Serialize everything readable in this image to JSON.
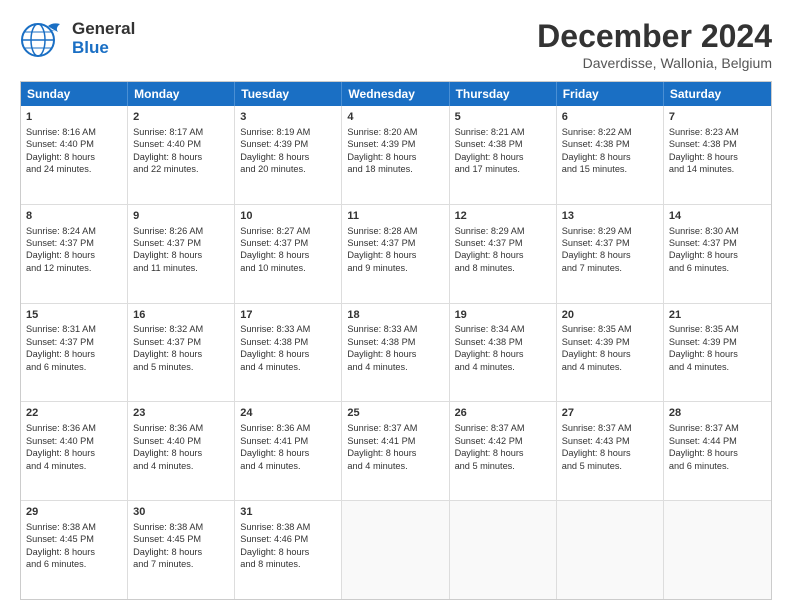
{
  "header": {
    "logo_line1": "General",
    "logo_line2": "Blue",
    "month": "December 2024",
    "location": "Daverdisse, Wallonia, Belgium"
  },
  "days_of_week": [
    "Sunday",
    "Monday",
    "Tuesday",
    "Wednesday",
    "Thursday",
    "Friday",
    "Saturday"
  ],
  "weeks": [
    [
      {
        "day": "1",
        "lines": [
          "Sunrise: 8:16 AM",
          "Sunset: 4:40 PM",
          "Daylight: 8 hours",
          "and 24 minutes."
        ]
      },
      {
        "day": "2",
        "lines": [
          "Sunrise: 8:17 AM",
          "Sunset: 4:40 PM",
          "Daylight: 8 hours",
          "and 22 minutes."
        ]
      },
      {
        "day": "3",
        "lines": [
          "Sunrise: 8:19 AM",
          "Sunset: 4:39 PM",
          "Daylight: 8 hours",
          "and 20 minutes."
        ]
      },
      {
        "day": "4",
        "lines": [
          "Sunrise: 8:20 AM",
          "Sunset: 4:39 PM",
          "Daylight: 8 hours",
          "and 18 minutes."
        ]
      },
      {
        "day": "5",
        "lines": [
          "Sunrise: 8:21 AM",
          "Sunset: 4:38 PM",
          "Daylight: 8 hours",
          "and 17 minutes."
        ]
      },
      {
        "day": "6",
        "lines": [
          "Sunrise: 8:22 AM",
          "Sunset: 4:38 PM",
          "Daylight: 8 hours",
          "and 15 minutes."
        ]
      },
      {
        "day": "7",
        "lines": [
          "Sunrise: 8:23 AM",
          "Sunset: 4:38 PM",
          "Daylight: 8 hours",
          "and 14 minutes."
        ]
      }
    ],
    [
      {
        "day": "8",
        "lines": [
          "Sunrise: 8:24 AM",
          "Sunset: 4:37 PM",
          "Daylight: 8 hours",
          "and 12 minutes."
        ]
      },
      {
        "day": "9",
        "lines": [
          "Sunrise: 8:26 AM",
          "Sunset: 4:37 PM",
          "Daylight: 8 hours",
          "and 11 minutes."
        ]
      },
      {
        "day": "10",
        "lines": [
          "Sunrise: 8:27 AM",
          "Sunset: 4:37 PM",
          "Daylight: 8 hours",
          "and 10 minutes."
        ]
      },
      {
        "day": "11",
        "lines": [
          "Sunrise: 8:28 AM",
          "Sunset: 4:37 PM",
          "Daylight: 8 hours",
          "and 9 minutes."
        ]
      },
      {
        "day": "12",
        "lines": [
          "Sunrise: 8:29 AM",
          "Sunset: 4:37 PM",
          "Daylight: 8 hours",
          "and 8 minutes."
        ]
      },
      {
        "day": "13",
        "lines": [
          "Sunrise: 8:29 AM",
          "Sunset: 4:37 PM",
          "Daylight: 8 hours",
          "and 7 minutes."
        ]
      },
      {
        "day": "14",
        "lines": [
          "Sunrise: 8:30 AM",
          "Sunset: 4:37 PM",
          "Daylight: 8 hours",
          "and 6 minutes."
        ]
      }
    ],
    [
      {
        "day": "15",
        "lines": [
          "Sunrise: 8:31 AM",
          "Sunset: 4:37 PM",
          "Daylight: 8 hours",
          "and 6 minutes."
        ]
      },
      {
        "day": "16",
        "lines": [
          "Sunrise: 8:32 AM",
          "Sunset: 4:37 PM",
          "Daylight: 8 hours",
          "and 5 minutes."
        ]
      },
      {
        "day": "17",
        "lines": [
          "Sunrise: 8:33 AM",
          "Sunset: 4:38 PM",
          "Daylight: 8 hours",
          "and 4 minutes."
        ]
      },
      {
        "day": "18",
        "lines": [
          "Sunrise: 8:33 AM",
          "Sunset: 4:38 PM",
          "Daylight: 8 hours",
          "and 4 minutes."
        ]
      },
      {
        "day": "19",
        "lines": [
          "Sunrise: 8:34 AM",
          "Sunset: 4:38 PM",
          "Daylight: 8 hours",
          "and 4 minutes."
        ]
      },
      {
        "day": "20",
        "lines": [
          "Sunrise: 8:35 AM",
          "Sunset: 4:39 PM",
          "Daylight: 8 hours",
          "and 4 minutes."
        ]
      },
      {
        "day": "21",
        "lines": [
          "Sunrise: 8:35 AM",
          "Sunset: 4:39 PM",
          "Daylight: 8 hours",
          "and 4 minutes."
        ]
      }
    ],
    [
      {
        "day": "22",
        "lines": [
          "Sunrise: 8:36 AM",
          "Sunset: 4:40 PM",
          "Daylight: 8 hours",
          "and 4 minutes."
        ]
      },
      {
        "day": "23",
        "lines": [
          "Sunrise: 8:36 AM",
          "Sunset: 4:40 PM",
          "Daylight: 8 hours",
          "and 4 minutes."
        ]
      },
      {
        "day": "24",
        "lines": [
          "Sunrise: 8:36 AM",
          "Sunset: 4:41 PM",
          "Daylight: 8 hours",
          "and 4 minutes."
        ]
      },
      {
        "day": "25",
        "lines": [
          "Sunrise: 8:37 AM",
          "Sunset: 4:41 PM",
          "Daylight: 8 hours",
          "and 4 minutes."
        ]
      },
      {
        "day": "26",
        "lines": [
          "Sunrise: 8:37 AM",
          "Sunset: 4:42 PM",
          "Daylight: 8 hours",
          "and 5 minutes."
        ]
      },
      {
        "day": "27",
        "lines": [
          "Sunrise: 8:37 AM",
          "Sunset: 4:43 PM",
          "Daylight: 8 hours",
          "and 5 minutes."
        ]
      },
      {
        "day": "28",
        "lines": [
          "Sunrise: 8:37 AM",
          "Sunset: 4:44 PM",
          "Daylight: 8 hours",
          "and 6 minutes."
        ]
      }
    ],
    [
      {
        "day": "29",
        "lines": [
          "Sunrise: 8:38 AM",
          "Sunset: 4:45 PM",
          "Daylight: 8 hours",
          "and 6 minutes."
        ]
      },
      {
        "day": "30",
        "lines": [
          "Sunrise: 8:38 AM",
          "Sunset: 4:45 PM",
          "Daylight: 8 hours",
          "and 7 minutes."
        ]
      },
      {
        "day": "31",
        "lines": [
          "Sunrise: 8:38 AM",
          "Sunset: 4:46 PM",
          "Daylight: 8 hours",
          "and 8 minutes."
        ]
      },
      {
        "day": "",
        "lines": []
      },
      {
        "day": "",
        "lines": []
      },
      {
        "day": "",
        "lines": []
      },
      {
        "day": "",
        "lines": []
      }
    ]
  ]
}
